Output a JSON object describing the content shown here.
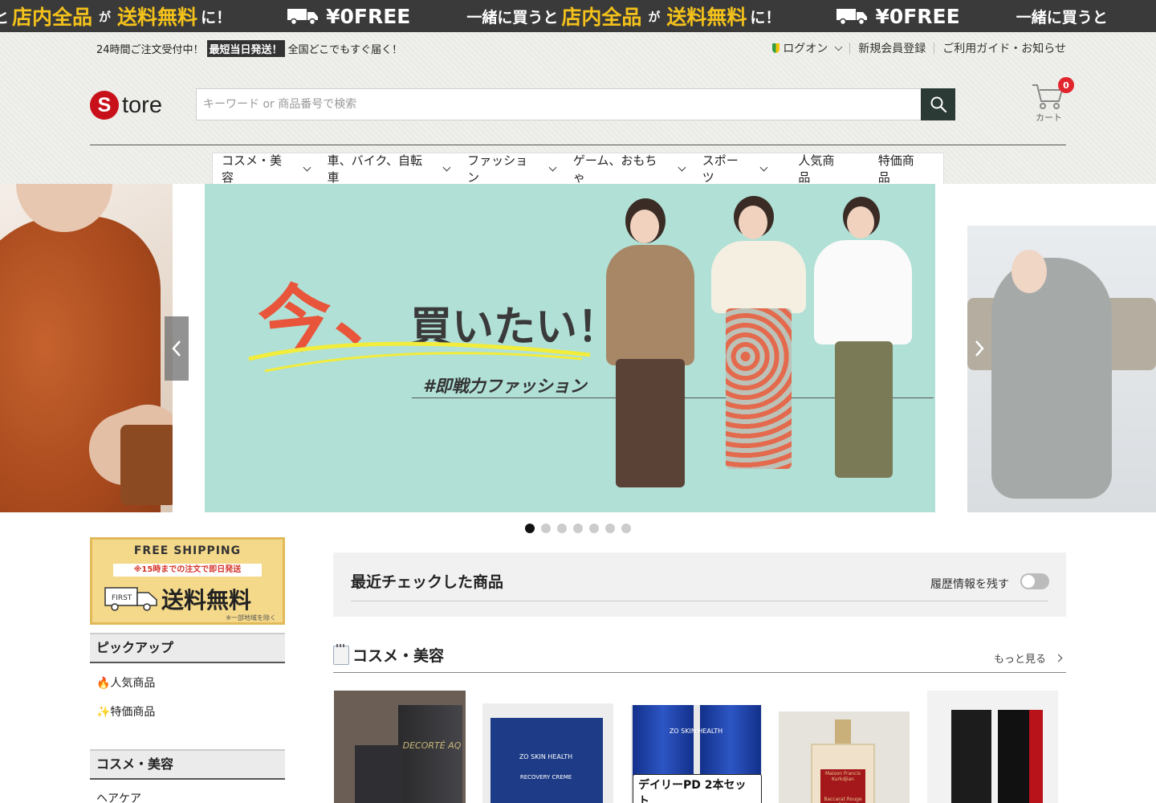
{
  "marquee": {
    "seg1": {
      "pre": "と",
      "yellow": "店内全品",
      "mid": "が",
      "yellow2": "送料無料",
      "post": "に！"
    },
    "free": "¥0FREE",
    "seg2": {
      "pre": "一緒に買うと",
      "yellow": "店内全品",
      "mid": "が",
      "yellow2": "送料無料",
      "post": "に！"
    },
    "seg3": {
      "pre": "一緒に買うと"
    }
  },
  "topbar": {
    "lead": "24時間ご注文受付中！",
    "badge": "最短当日発送！",
    "tail": "全国どこでもすぐ届く！"
  },
  "topright": {
    "login": "ログオン",
    "register": "新規会員登録",
    "guide": "ご利用ガイド・お知らせ"
  },
  "logo": {
    "initial": "S",
    "rest": "tore"
  },
  "search": {
    "placeholder": "キーワード or 商品番号で検索"
  },
  "cart": {
    "count": "0",
    "label": "カート"
  },
  "nav": [
    {
      "label": "コスメ・美容",
      "has_dropdown": true
    },
    {
      "label": "車、バイク、自転車",
      "has_dropdown": true
    },
    {
      "label": "ファッション",
      "has_dropdown": true
    },
    {
      "label": "ゲーム、おもちゃ",
      "has_dropdown": true
    },
    {
      "label": "スポーツ",
      "has_dropdown": true
    },
    {
      "label": "人気商品",
      "has_dropdown": false
    },
    {
      "label": "特価商品",
      "has_dropdown": false
    }
  ],
  "hero": {
    "headline_big": "今、",
    "headline_rest": "買いたい！",
    "tag": "#即戦力ファッション",
    "slide_count": 7,
    "active_slide": 1
  },
  "sidebar": {
    "ship_banner": {
      "top": "FREE SHIPPING",
      "red": "※15時までの注文で即日発送",
      "truck_text": "FIRST",
      "big": "送料無料",
      "note": "※一部地域を除く"
    },
    "pickup_title": "ピックアップ",
    "pickup_items": [
      "🔥人気商品",
      "✨特価商品"
    ],
    "cosme_title": "コスメ・美容",
    "cosme_items": [
      "ヘアケア"
    ]
  },
  "recent": {
    "title": "最近チェックした商品",
    "toggle_label": "履歴情報を残す",
    "toggle_on": false
  },
  "category": {
    "title": "コスメ・美容",
    "more": "もっと見る"
  },
  "products": [
    {
      "brand": "DECORTÉ AQ"
    },
    {
      "brand": "ZO SKIN HEALTH",
      "sub": "RECOVERY CREME"
    },
    {
      "brand": "ZO SKIN HEALTH",
      "label": "デイリーPD 2本セット"
    },
    {
      "brand": "Maison Francis Kurkdjian",
      "sub": "Baccarat Rouge 540"
    },
    {
      "brand": ""
    }
  ],
  "colors": {
    "marquee_bg": "#3a3a3a",
    "marquee_yellow": "#f4c21b",
    "logo_red": "#c8101a",
    "search_btn": "#2b3a34",
    "cart_badge": "#e2242c",
    "banner_bg": "#b1e0d6",
    "banner_accent": "#e8553a"
  }
}
